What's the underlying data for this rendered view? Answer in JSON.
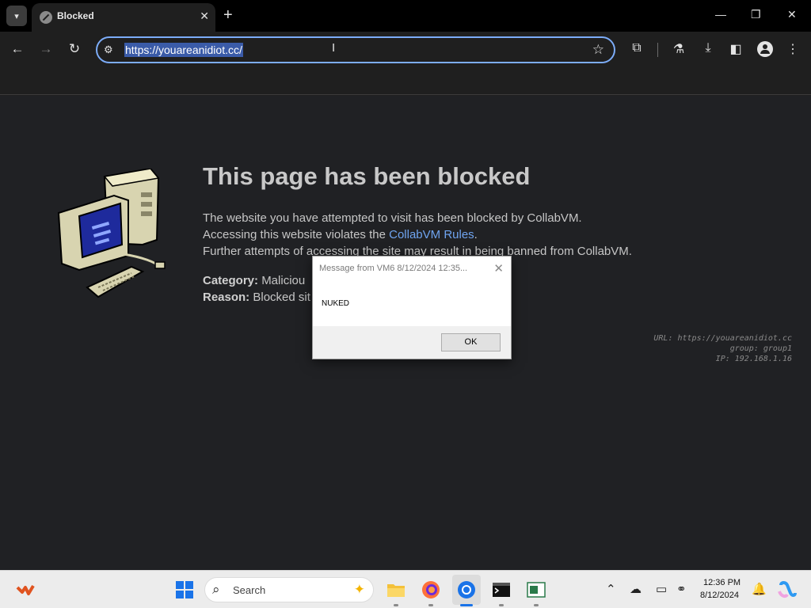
{
  "tab": {
    "title": "Blocked",
    "close_glyph": "✕"
  },
  "toolbar": {
    "url": "https://youareanidiot.cc/"
  },
  "page": {
    "title": "This page has been blocked",
    "line1": "The website you have attempted to visit has been blocked by CollabVM.",
    "line2_prefix": "Accessing this website violates the ",
    "line2_link": "CollabVM Rules",
    "line2_suffix": ".",
    "line3": "Further attempts of accessing the site may result in being banned from CollabVM.",
    "category_label": "Category:",
    "category_value": "Maliciou",
    "reason_label": "Reason:",
    "reason_value": "Blocked sit",
    "meta_url": "URL: https://youareanidiot.cc",
    "meta_group": "group: group1",
    "meta_ip": "IP: 192.168.1.16"
  },
  "dialog": {
    "title": "Message from VM6 8/12/2024 12:35...",
    "message": "NUKED",
    "ok_label": "OK"
  },
  "taskbar": {
    "search_label": "Search",
    "time": "12:36 PM",
    "date": "8/12/2024"
  },
  "colors": {
    "accent_blue": "#7cacf8",
    "link_blue": "#6fa4f0",
    "page_bg": "#202124",
    "taskbar_bg": "#ececec"
  }
}
